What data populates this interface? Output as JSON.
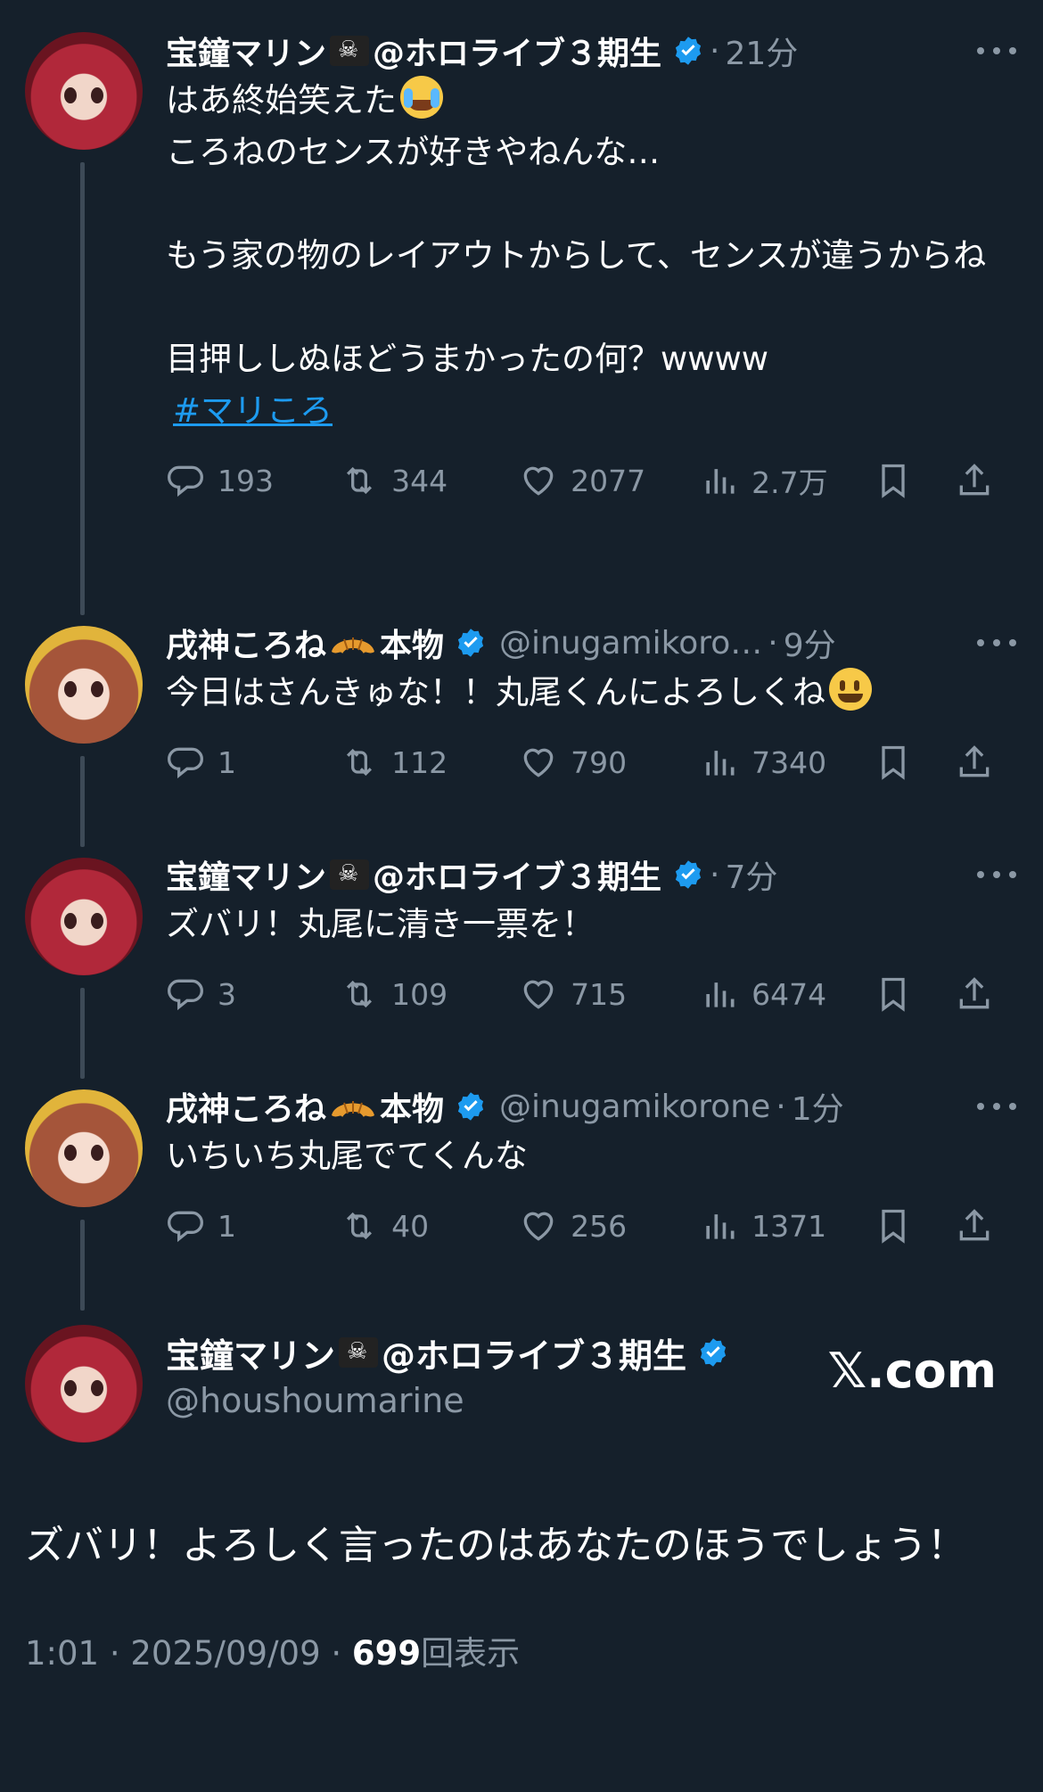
{
  "tweets": [
    {
      "author": "宝鐘マリン",
      "author_suffix": "@ホロライブ３期生",
      "handle": "",
      "time": "21分",
      "text": "はあ終始笑えた",
      "text_after_emoji": "\nころねのセンスが好きやねんな…\n\nもう家の物のレイアウトからして、センスが違うからね\n\n目押ししぬほどうまかったの何？wwww",
      "hashtag": "#マリころ",
      "replies": "193",
      "retweets": "344",
      "likes": "2077",
      "views": "2.7万"
    },
    {
      "author": "戌神ころね",
      "author_suffix": "本物",
      "handle": "@inugamikoro…",
      "time": "9分",
      "text": "今日はさんきゅな！！丸尾くんによろしくね",
      "replies": "1",
      "retweets": "112",
      "likes": "790",
      "views": "7340"
    },
    {
      "author": "宝鐘マリン",
      "author_suffix": "@ホロライブ３期生",
      "handle": "",
      "time": "7分",
      "text": "ズバリ！丸尾に清き一票を！",
      "replies": "3",
      "retweets": "109",
      "likes": "715",
      "views": "6474"
    },
    {
      "author": "戌神ころね",
      "author_suffix": "本物",
      "handle": "@inugamikorone",
      "time": "1分",
      "text": "いちいち丸尾でてくんな",
      "replies": "1",
      "retweets": "40",
      "likes": "256",
      "views": "1371"
    }
  ],
  "main_tweet": {
    "author": "宝鐘マリン",
    "author_suffix": "@ホロライブ３期生",
    "handle": "@houshoumarine",
    "watermark": "𝕏.com",
    "text": "ズバリ！よろしく言ったのはあなたのほうでしょう！",
    "timestamp": "1:01 · 2025/09/09 · ",
    "view_count": "699",
    "view_label": "回表示"
  },
  "colors": {
    "background": "#15202b",
    "muted": "#8b98a5",
    "accent": "#1d9bf0",
    "thread_line": "#3d4a57"
  },
  "icons": [
    "reply-icon",
    "retweet-icon",
    "like-icon",
    "views-icon",
    "bookmark-icon",
    "share-icon",
    "verified-badge-icon",
    "more-icon",
    "pirate-flag-icon",
    "croissant-icon"
  ]
}
